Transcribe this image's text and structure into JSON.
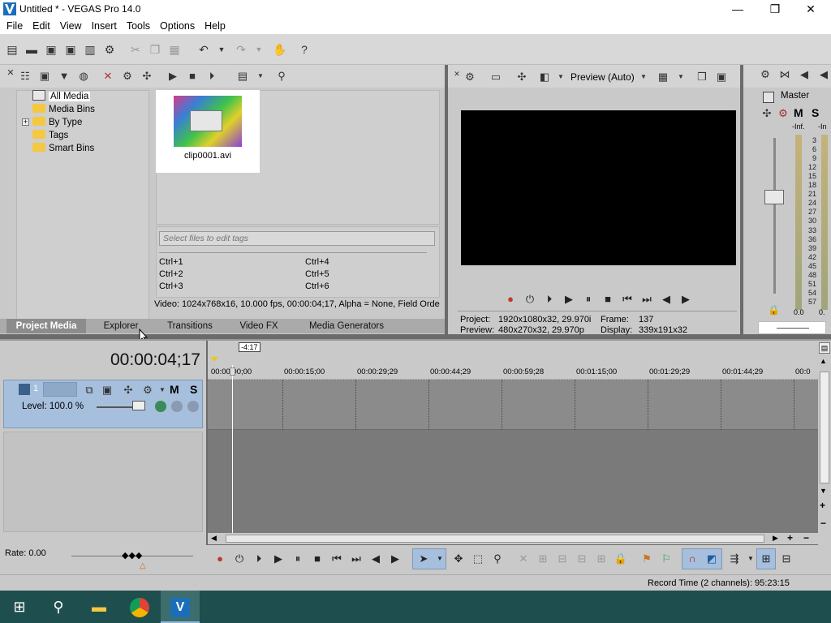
{
  "window": {
    "title": "Untitled * - VEGAS Pro 14.0",
    "minimize": "—",
    "maximize": "❐",
    "close": "✕"
  },
  "menu": [
    "File",
    "Edit",
    "View",
    "Insert",
    "Tools",
    "Options",
    "Help"
  ],
  "project_media": {
    "tree": [
      "All Media",
      "Media Bins",
      "By Type",
      "Tags",
      "Smart Bins"
    ],
    "tree_expander": "+",
    "clip_name": "clip0001.avi",
    "tags_placeholder": "Select files to edit tags",
    "shortcuts": [
      "Ctrl+1",
      "Ctrl+4",
      "Ctrl+2",
      "Ctrl+5",
      "Ctrl+3",
      "Ctrl+6"
    ],
    "media_info": "Video: 1024x768x16, 10.000 fps, 00:00:04;17, Alpha = None, Field Orde"
  },
  "dock_tabs": [
    "Project Media",
    "Explorer",
    "Transitions",
    "Video FX",
    "Media Generators"
  ],
  "preview": {
    "mode_label": "Preview (Auto)",
    "project_label": "Project:",
    "project_value": "1920x1080x32, 29.970i",
    "preview_label": "Preview:",
    "preview_value": "480x270x32, 29.970p",
    "frame_label": "Frame:",
    "frame_value": "137",
    "display_label": "Display:",
    "display_value": "339x191x32"
  },
  "master": {
    "label": "Master",
    "left_db": "-Inf.",
    "right_db": "-In",
    "scale": [
      "3",
      "6",
      "9",
      "12",
      "15",
      "18",
      "21",
      "24",
      "27",
      "30",
      "33",
      "36",
      "39",
      "42",
      "45",
      "48",
      "51",
      "54",
      "57"
    ],
    "fader_value": "0.0",
    "fader_value_right": "0.",
    "m_label": "M",
    "s_label": "S"
  },
  "timeline": {
    "timecode": "00:00:04;17",
    "region_marker": "-4:17",
    "ruler": [
      "00:00:00;00",
      "00:00:15;00",
      "00:00:29;29",
      "00:00:44;29",
      "00:00:59;28",
      "00:01:15;00",
      "00:01:29;29",
      "00:01:44;29",
      "00:0"
    ],
    "track": {
      "number": "1",
      "level_label": "Level: 100.0 %",
      "mute": "M",
      "solo": "S"
    },
    "rate_label": "Rate: 0.00"
  },
  "status": {
    "record_time": "Record Time (2 channels): 95:23:15"
  },
  "colors": {
    "track_header": "#a6bfdc",
    "timeline_bg": "#7a7a7a",
    "taskbar": "#1f4e4f",
    "record_red": "#c0392b"
  }
}
